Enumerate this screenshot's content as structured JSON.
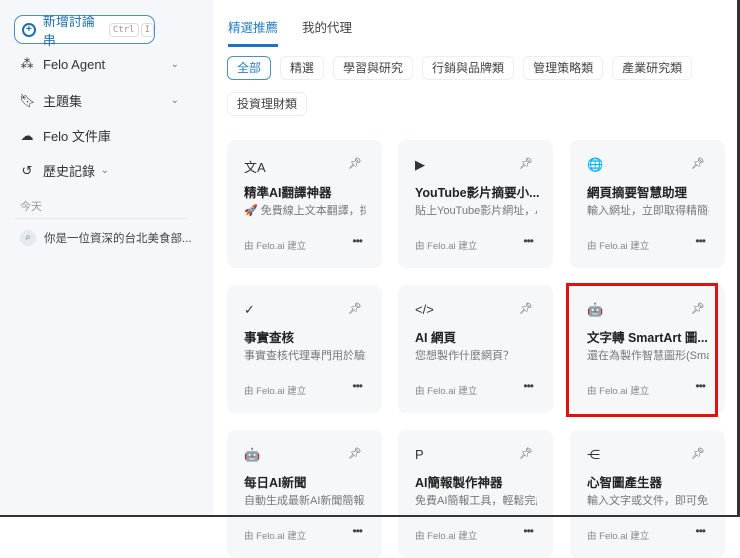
{
  "sidebar": {
    "new_thread": "新增討論串",
    "kbd1": "Ctrl",
    "kbd2": "I",
    "items": [
      {
        "label": "Felo Agent",
        "icon": "agent-icon"
      },
      {
        "label": "主題集",
        "icon": "bookmark-icon"
      },
      {
        "label": "Felo 文件庫",
        "icon": "cloud-upload-icon"
      },
      {
        "label": "歷史記錄",
        "icon": "history-icon"
      }
    ],
    "today": "今天",
    "history": [
      "你是一位資深的台北美食部..."
    ]
  },
  "tabs": [
    "精選推薦",
    "我的代理"
  ],
  "chips": [
    "全部",
    "精選",
    "學習與研究",
    "行銷與品牌類",
    "管理策略類",
    "產業研究類",
    "投資理財類"
  ],
  "card_by": "由 Felo.ai 建立",
  "cards": [
    {
      "icon": "translate-icon",
      "glyph": "文A",
      "title": "精準AI翻譯神器",
      "desc": "🚀 免費線上文本翻譯，採."
    },
    {
      "icon": "play-icon",
      "glyph": "▶",
      "title": "YouTube影片摘要小...",
      "desc": "貼上YouTube影片網址，A"
    },
    {
      "icon": "globe-icon",
      "glyph": "🌐",
      "title": "網頁摘要智慧助理",
      "desc": "輸入網址，立即取得精簡摘"
    },
    {
      "icon": "check-badge-icon",
      "glyph": "✓",
      "title": "事實查核",
      "desc": "事實查核代理專門用於驗證"
    },
    {
      "icon": "code-window-icon",
      "glyph": "</>",
      "title": "AI 網頁",
      "desc": "您想製作什麼網頁？"
    },
    {
      "icon": "robot-icon",
      "glyph": "🤖",
      "title": "文字轉 SmartArt 圖...",
      "desc": "還在為製作智慧圖形(Smar"
    },
    {
      "icon": "robot-icon",
      "glyph": "🤖",
      "title": "每日AI新聞",
      "desc": "自動生成最新AI新聞簡報"
    },
    {
      "icon": "slides-icon",
      "glyph": "P",
      "title": "AI簡報製作神器",
      "desc": "免費AI簡報工具，輕鬆完成"
    },
    {
      "icon": "mindmap-icon",
      "glyph": "⋲",
      "title": "心智圖產生器",
      "desc": "輸入文字或文件，即可免費"
    }
  ]
}
